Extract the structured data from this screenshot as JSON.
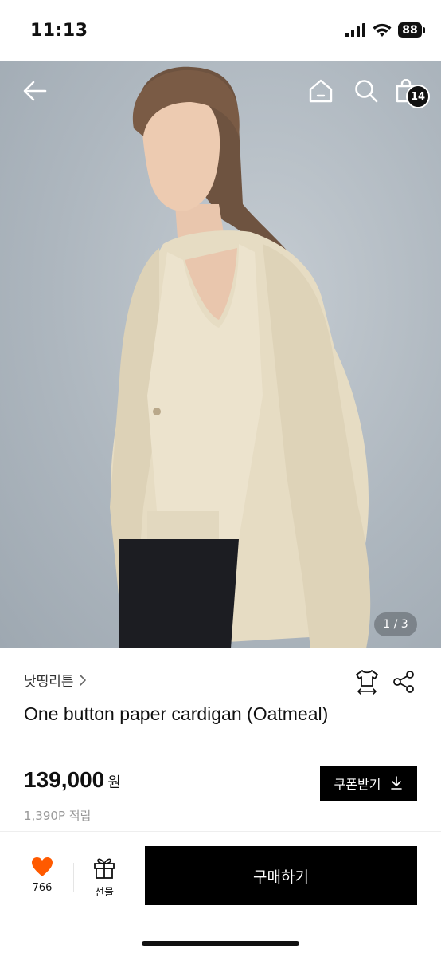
{
  "status_bar": {
    "time": "11:13",
    "battery": "88"
  },
  "header": {
    "cart_count": "14"
  },
  "gallery": {
    "indicator": "1 / 3"
  },
  "product": {
    "brand": "낫띵리튼",
    "title": "One button paper cardigan (Oatmeal)",
    "price": "139,000",
    "price_unit": "원",
    "points": "1,390P 적립"
  },
  "coupon": {
    "label": "쿠폰받기"
  },
  "bottom_bar": {
    "like_count": "766",
    "gift_label": "선물",
    "buy_label": "구매하기"
  },
  "colors": {
    "accent": "#ff5a00",
    "primary": "#000000"
  }
}
